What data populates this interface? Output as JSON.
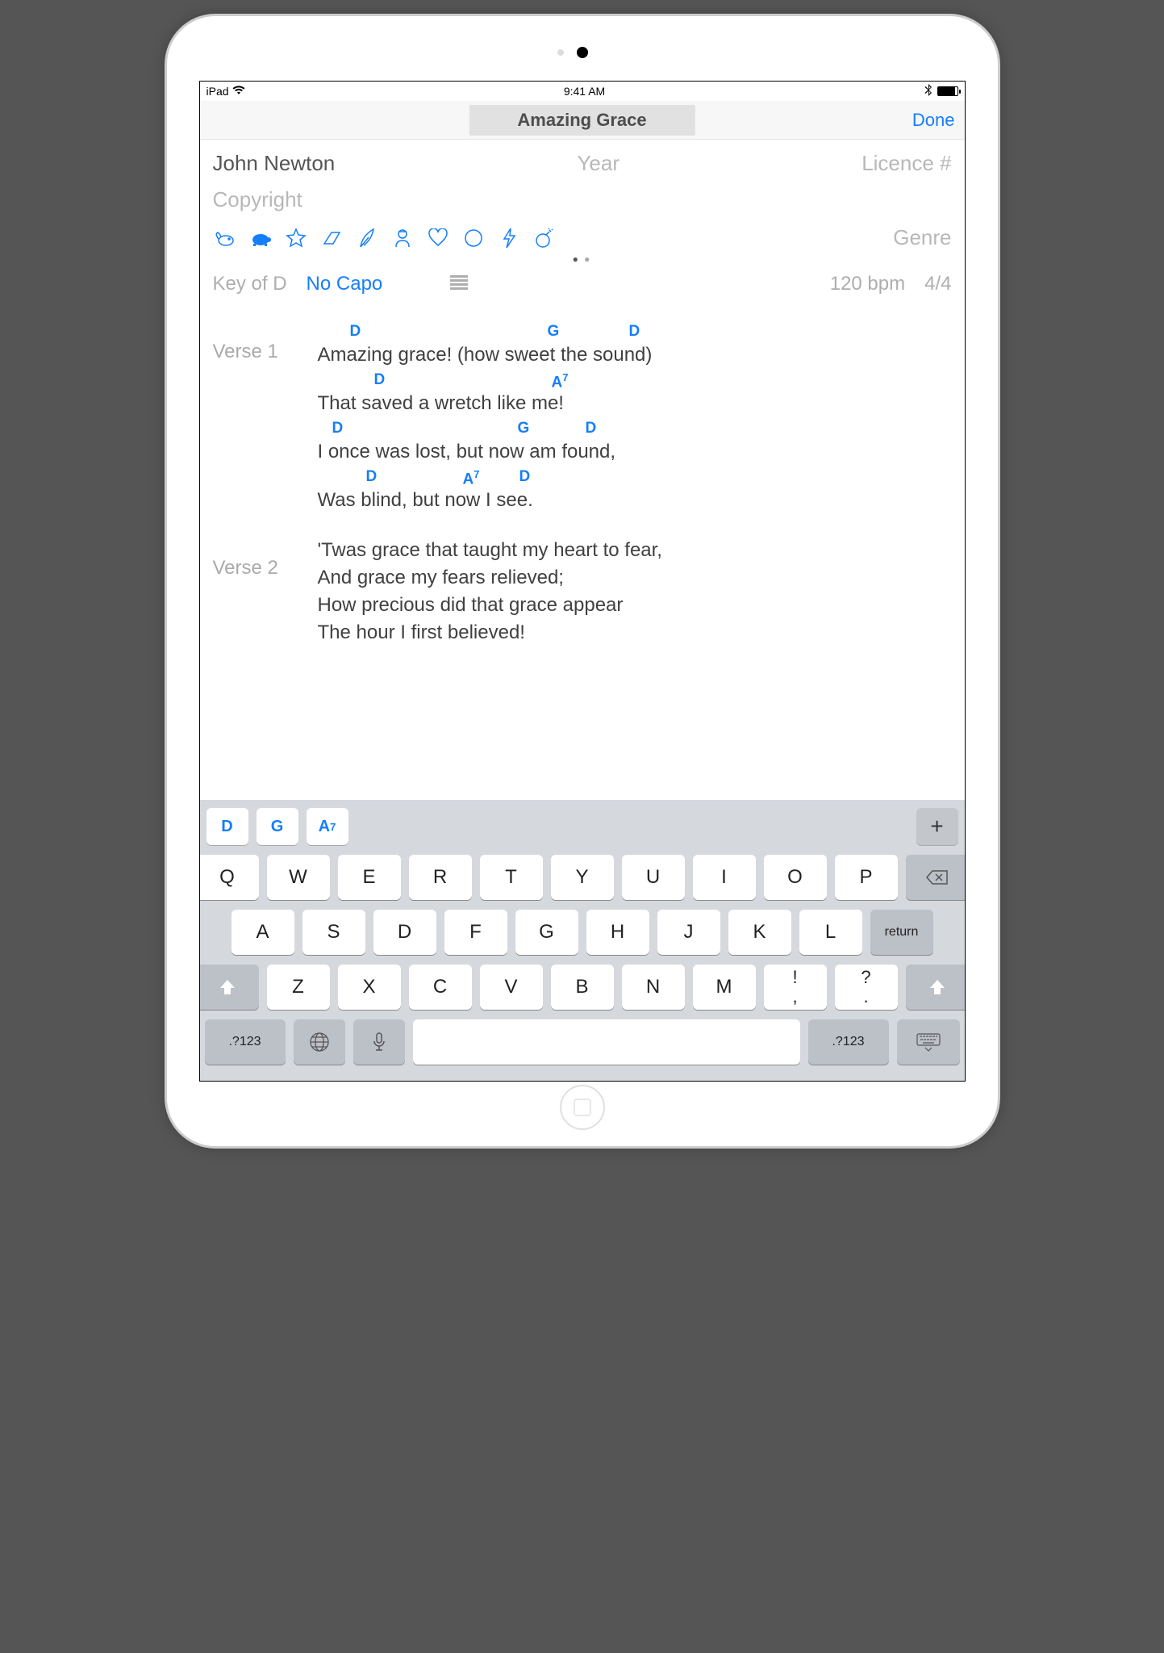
{
  "status": {
    "carrier": "iPad",
    "time": "9:41 AM"
  },
  "nav": {
    "title": "Amazing Grace",
    "done": "Done"
  },
  "meta": {
    "artist": "John Newton",
    "year_placeholder": "Year",
    "licence_placeholder": "Licence #",
    "copyright_placeholder": "Copyright",
    "genre_placeholder": "Genre"
  },
  "settings": {
    "key": "Key of D",
    "capo": "No Capo",
    "bpm": "120 bpm",
    "time_signature": "4/4"
  },
  "lyrics": {
    "sections": [
      {
        "label": "Verse 1",
        "lines": [
          {
            "text": "Amazing grace! (how sweet the sound)",
            "chords": [
              {
                "chord": "D",
                "pos": 40
              },
              {
                "chord": "G",
                "pos": 285
              },
              {
                "chord": "D",
                "pos": 386
              }
            ]
          },
          {
            "text": "That saved a wretch like me!",
            "chords": [
              {
                "chord": "D",
                "pos": 70
              },
              {
                "chord": "A",
                "sup": "7",
                "pos": 290
              }
            ]
          },
          {
            "text": "I once was lost, but now am found,",
            "chords": [
              {
                "chord": "D",
                "pos": 18
              },
              {
                "chord": "G",
                "pos": 248
              },
              {
                "chord": "D",
                "pos": 332
              }
            ]
          },
          {
            "text": "Was blind, but now I see.",
            "chords": [
              {
                "chord": "D",
                "pos": 60
              },
              {
                "chord": "A",
                "sup": "7",
                "pos": 180
              },
              {
                "chord": "D",
                "pos": 250
              }
            ]
          }
        ]
      },
      {
        "label": "Verse 2",
        "lines": [
          {
            "text": "'Twas grace that taught my heart to fear,"
          },
          {
            "text": "And grace my fears relieved;"
          },
          {
            "text": "How precious did that grace appear"
          },
          {
            "text": "The hour I first believed!"
          }
        ]
      }
    ]
  },
  "chord_bar": [
    "D",
    "G",
    {
      "chord": "A",
      "sup": "7"
    }
  ],
  "keyboard": {
    "row1": [
      "Q",
      "W",
      "E",
      "R",
      "T",
      "Y",
      "U",
      "I",
      "O",
      "P"
    ],
    "row2": [
      "A",
      "S",
      "D",
      "F",
      "G",
      "H",
      "J",
      "K",
      "L"
    ],
    "return": "return",
    "row3": [
      "Z",
      "X",
      "C",
      "V",
      "B",
      "N",
      "M"
    ],
    "punct": [
      {
        "top": "!",
        "bot": ","
      },
      {
        "top": "?",
        "bot": "."
      }
    ],
    "mode": ".?123"
  }
}
